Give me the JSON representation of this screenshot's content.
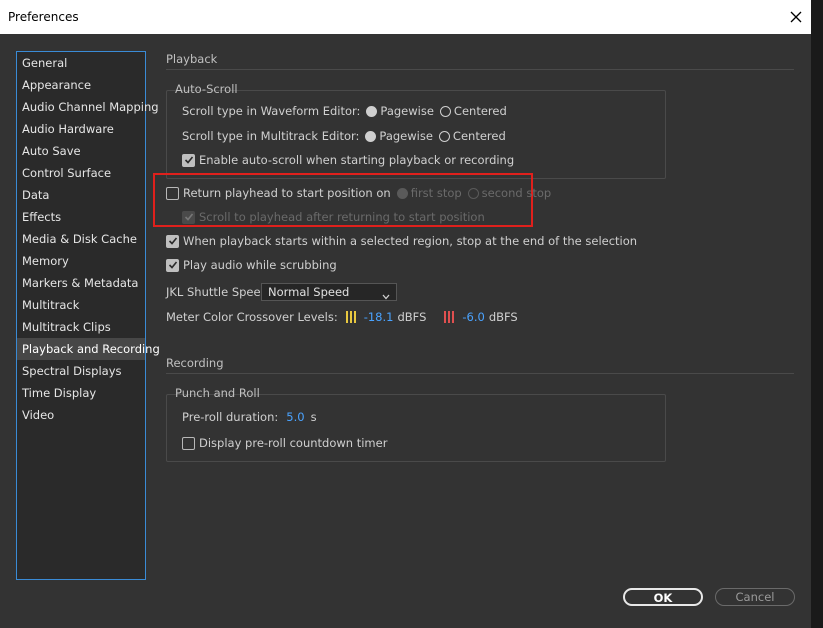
{
  "window": {
    "title": "Preferences"
  },
  "sidebar": {
    "items": [
      {
        "label": "General"
      },
      {
        "label": "Appearance"
      },
      {
        "label": "Audio Channel Mapping"
      },
      {
        "label": "Audio Hardware"
      },
      {
        "label": "Auto Save"
      },
      {
        "label": "Control Surface"
      },
      {
        "label": "Data"
      },
      {
        "label": "Effects"
      },
      {
        "label": "Media & Disk Cache"
      },
      {
        "label": "Memory"
      },
      {
        "label": "Markers & Metadata"
      },
      {
        "label": "Multitrack"
      },
      {
        "label": "Multitrack Clips"
      },
      {
        "label": "Playback and Recording",
        "selected": true
      },
      {
        "label": "Spectral Displays"
      },
      {
        "label": "Time Display"
      },
      {
        "label": "Video"
      }
    ]
  },
  "playback": {
    "title": "Playback",
    "autoscroll": {
      "group_label": "Auto-Scroll",
      "waveform_label": "Scroll type in Waveform Editor:",
      "multitrack_label": "Scroll type in Multitrack Editor:",
      "pagewise": "Pagewise",
      "centered": "Centered",
      "waveform_selected": "Pagewise",
      "multitrack_selected": "Pagewise",
      "enable_label": "Enable auto-scroll when starting playback or recording",
      "enable_checked": true
    },
    "return_playhead": {
      "label": "Return playhead to start position on",
      "checked": false,
      "first_stop": "first stop",
      "second_stop": "second stop",
      "scroll_label": "Scroll to playhead after returning to start position",
      "scroll_checked": true
    },
    "stop_at_selection": {
      "label": "When playback starts within a selected region, stop at the end of the selection",
      "checked": true
    },
    "scrub_audio": {
      "label": "Play audio while scrubbing",
      "checked": true
    },
    "jkl": {
      "label": "JKL Shuttle Speed:",
      "value": "Normal Speed"
    },
    "meter": {
      "label": "Meter Color Crossover Levels:",
      "level1_value": "-18.1",
      "level2_value": "-6.0",
      "unit": "dBFS",
      "level1_color": "#e8c840",
      "level2_color": "#e05050"
    }
  },
  "recording": {
    "title": "Recording",
    "punch": {
      "group_label": "Punch and Roll",
      "preroll_label": "Pre-roll duration:",
      "preroll_value": "5.0",
      "preroll_unit": "s",
      "countdown_label": "Display pre-roll countdown timer",
      "countdown_checked": false
    }
  },
  "buttons": {
    "ok": "OK",
    "cancel": "Cancel"
  },
  "colors": {
    "accent": "#3a8bd6",
    "highlight": "#e0201c",
    "value": "#4aa3ff"
  }
}
